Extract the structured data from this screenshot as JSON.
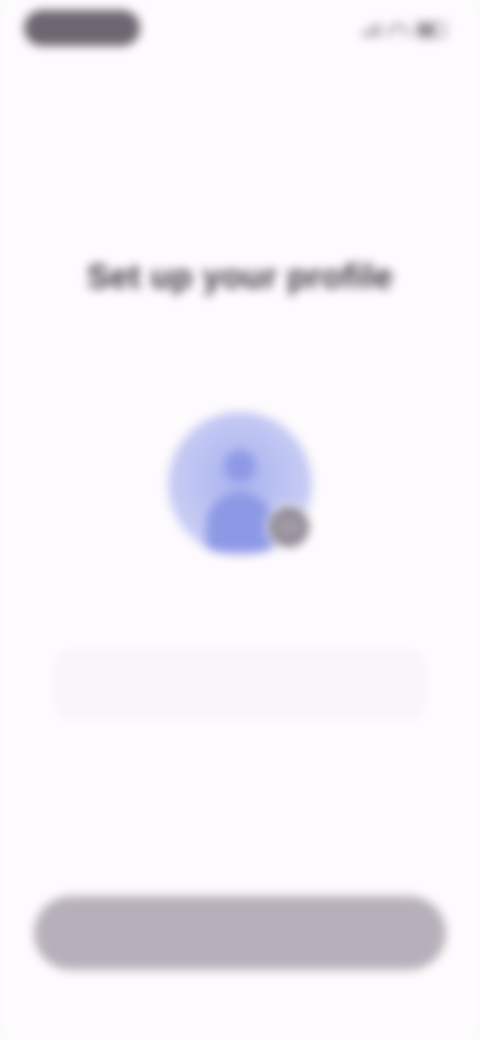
{
  "status_bar": {
    "time": "",
    "icons": [
      "signal-icon",
      "wifi-icon",
      "battery-icon"
    ]
  },
  "header": {
    "skip_label": ""
  },
  "main": {
    "title": "Set up your profile",
    "subtitle": "",
    "avatar_icon": "person-icon",
    "camera_icon": "camera-icon",
    "photo_hint": "",
    "name_placeholder": ""
  },
  "footer": {
    "continue_label": ""
  },
  "colors": {
    "background": "#fdfbfd",
    "avatar_accent": "#8e99e6",
    "button_disabled": "#b7b0ba"
  }
}
